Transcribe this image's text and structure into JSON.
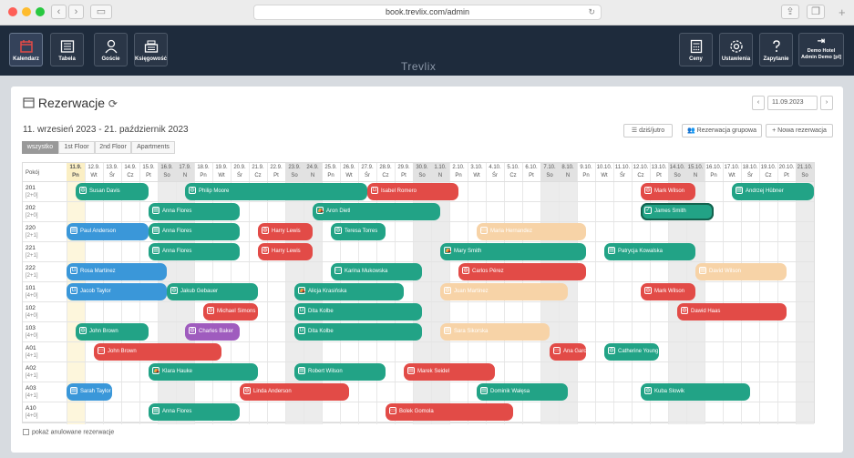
{
  "browser": {
    "url": "book.trevlix.com/admin"
  },
  "nav": {
    "brand": "Trevlix",
    "left": [
      {
        "label": "Kalendarz",
        "icon": "calendar-icon",
        "active": true
      },
      {
        "label": "Tabela",
        "icon": "table-icon"
      },
      {
        "label": "Goście",
        "icon": "user-icon"
      },
      {
        "label": "Księgowość",
        "icon": "cash-register-icon"
      }
    ],
    "right": [
      {
        "label": "Ceny",
        "icon": "calculator-icon"
      },
      {
        "label": "Ustawienia",
        "icon": "gear-icon"
      },
      {
        "label": "Zapytanie",
        "icon": "question-icon"
      }
    ],
    "hotel": {
      "line1": "Demo Hotel",
      "line2": "Admin Demo [pl]"
    }
  },
  "page": {
    "title": "Rezerwacje",
    "date": "11.09.2023",
    "range": "11. wrzesień 2023 - 21. październik 2023",
    "buttons": {
      "today": "dziś/jutro",
      "group": "Rezerwacja grupowa",
      "new": "+ Nowa rezerwacja"
    },
    "tabs": [
      "wszystko",
      "1st Floor",
      "2nd Floor",
      "Apartments"
    ],
    "column_header": "Pokój",
    "show_cancelled": "pokaż anulowane rezerwacje"
  },
  "days": [
    [
      "11.9.",
      "Pn"
    ],
    [
      "12.9.",
      "Wt"
    ],
    [
      "13.9.",
      "Śr"
    ],
    [
      "14.9.",
      "Cz"
    ],
    [
      "15.9.",
      "Pt"
    ],
    [
      "16.9.",
      "So"
    ],
    [
      "17.9.",
      "N"
    ],
    [
      "18.9.",
      "Pn"
    ],
    [
      "19.9.",
      "Wt"
    ],
    [
      "20.9.",
      "Śr"
    ],
    [
      "21.9.",
      "Cz"
    ],
    [
      "22.9.",
      "Pt"
    ],
    [
      "23.9.",
      "So"
    ],
    [
      "24.9.",
      "N"
    ],
    [
      "25.9.",
      "Pn"
    ],
    [
      "26.9.",
      "Wt"
    ],
    [
      "27.9.",
      "Śr"
    ],
    [
      "28.9.",
      "Cz"
    ],
    [
      "29.9.",
      "Pt"
    ],
    [
      "30.9.",
      "So"
    ],
    [
      "1.10.",
      "N"
    ],
    [
      "2.10.",
      "Pn"
    ],
    [
      "3.10.",
      "Wt"
    ],
    [
      "4.10.",
      "Śr"
    ],
    [
      "5.10.",
      "Cz"
    ],
    [
      "6.10.",
      "Pt"
    ],
    [
      "7.10.",
      "So"
    ],
    [
      "8.10.",
      "N"
    ],
    [
      "9.10.",
      "Pn"
    ],
    [
      "10.10.",
      "Wt"
    ],
    [
      "11.10.",
      "Śr"
    ],
    [
      "12.10.",
      "Cz"
    ],
    [
      "13.10.",
      "Pt"
    ],
    [
      "14.10.",
      "So"
    ],
    [
      "15.10.",
      "N"
    ],
    [
      "16.10.",
      "Pn"
    ],
    [
      "17.10.",
      "Wt"
    ],
    [
      "18.10.",
      "Śr"
    ],
    [
      "19.10.",
      "Cz"
    ],
    [
      "20.10.",
      "Pt"
    ],
    [
      "21.10.",
      "So"
    ]
  ],
  "rooms": [
    {
      "name": "201",
      "cap": "[2+0]"
    },
    {
      "name": "202",
      "cap": "[2+0]"
    },
    {
      "name": "220",
      "cap": "[2+1]"
    },
    {
      "name": "221",
      "cap": "[2+1]"
    },
    {
      "name": "222",
      "cap": "[2+1]"
    },
    {
      "name": "101",
      "cap": "[4+0]"
    },
    {
      "name": "102",
      "cap": "[4+0]"
    },
    {
      "name": "103",
      "cap": "[4+0]"
    },
    {
      "name": "A01",
      "cap": "[4+1]"
    },
    {
      "name": "A02",
      "cap": "[4+1]"
    },
    {
      "name": "A03",
      "cap": "[4+1]"
    },
    {
      "name": "A10",
      "cap": "[4+0]"
    }
  ],
  "reservations": [
    {
      "row": 0,
      "start": 0.5,
      "end": 4.5,
      "name": "Susan Davis",
      "color": "g",
      "icon": "globe"
    },
    {
      "row": 0,
      "start": 6.5,
      "end": 16.5,
      "name": "Philip Moore",
      "color": "g",
      "icon": "globe"
    },
    {
      "row": 0,
      "start": 16.5,
      "end": 21.5,
      "name": "Isabel Romero",
      "color": "r",
      "icon": "G"
    },
    {
      "row": 0,
      "start": 31.5,
      "end": 34.5,
      "name": "Mark Wilson",
      "color": "r",
      "icon": "globe"
    },
    {
      "row": 0,
      "start": 36.5,
      "end": 43,
      "name": "Andrzej Hübner",
      "color": "g",
      "icon": "card"
    },
    {
      "row": 1,
      "start": 4.5,
      "end": 9.5,
      "name": "Anna Flores",
      "color": "g",
      "icon": "card"
    },
    {
      "row": 1,
      "start": 13.5,
      "end": 20.5,
      "name": "Aron Dietl",
      "color": "g",
      "icon": "tent"
    },
    {
      "row": 1,
      "start": 31.5,
      "end": 35.5,
      "name": "James Smith",
      "color": "g",
      "icon": "check",
      "sel": true
    },
    {
      "row": 2,
      "start": 0,
      "end": 4.5,
      "name": "Paul Anderson",
      "color": "b",
      "icon": "card"
    },
    {
      "row": 2,
      "start": 4.5,
      "end": 9.5,
      "name": "Anna Flores",
      "color": "g",
      "icon": "card"
    },
    {
      "row": 2,
      "start": 10.5,
      "end": 13.5,
      "name": "Harry Lewis",
      "color": "r",
      "icon": "globe"
    },
    {
      "row": 2,
      "start": 14.5,
      "end": 17.5,
      "name": "Teresa Torres",
      "color": "g",
      "icon": "globe"
    },
    {
      "row": 2,
      "start": 22.5,
      "end": 28.5,
      "name": "Maria Hernandez",
      "color": "o",
      "icon": "screen"
    },
    {
      "row": 3,
      "start": 4.5,
      "end": 9.5,
      "name": "Anna Flores",
      "color": "g",
      "icon": "card"
    },
    {
      "row": 3,
      "start": 10.5,
      "end": 13.5,
      "name": "Harry Lewis",
      "color": "r",
      "icon": "globe"
    },
    {
      "row": 3,
      "start": 20.5,
      "end": 28.5,
      "name": "Mary Smith",
      "color": "g",
      "icon": "tent"
    },
    {
      "row": 3,
      "start": 29.5,
      "end": 34.5,
      "name": "Patrycja Kowalska",
      "color": "g",
      "icon": "card"
    },
    {
      "row": 4,
      "start": 0,
      "end": 5.5,
      "name": "Rosa Martinez",
      "color": "b",
      "icon": "G"
    },
    {
      "row": 4,
      "start": 14.5,
      "end": 19.5,
      "name": "Karina Mukowska",
      "color": "g",
      "icon": "screen"
    },
    {
      "row": 4,
      "start": 21.5,
      "end": 28.5,
      "name": "Carlos Pérez",
      "color": "r",
      "icon": "globe"
    },
    {
      "row": 4,
      "start": 34.5,
      "end": 39.5,
      "name": "David Wilson",
      "color": "o",
      "icon": "card"
    },
    {
      "row": 5,
      "start": 0,
      "end": 5.5,
      "name": "Jacob Taylor",
      "color": "b",
      "icon": "G"
    },
    {
      "row": 5,
      "start": 5.5,
      "end": 10.5,
      "name": "Jakub Gebauer",
      "color": "g",
      "icon": "globe"
    },
    {
      "row": 5,
      "start": 12.5,
      "end": 18.5,
      "name": "Alicja Krasińska",
      "color": "g",
      "icon": "tent"
    },
    {
      "row": 5,
      "start": 20.5,
      "end": 27.5,
      "name": "Juan Martinez",
      "color": "o",
      "icon": "globe"
    },
    {
      "row": 5,
      "start": 31.5,
      "end": 34.5,
      "name": "Mark Wilson",
      "color": "r",
      "icon": "globe"
    },
    {
      "row": 6,
      "start": 7.5,
      "end": 10.5,
      "name": "Michael Simons",
      "color": "r",
      "icon": "globe"
    },
    {
      "row": 6,
      "start": 12.5,
      "end": 19.5,
      "name": "Dita Kolbe",
      "color": "g",
      "icon": "G"
    },
    {
      "row": 6,
      "start": 33.5,
      "end": 39.5,
      "name": "Dawid Haas",
      "color": "r",
      "icon": "globe"
    },
    {
      "row": 7,
      "start": 0.5,
      "end": 4.5,
      "name": "John Brown",
      "color": "g",
      "icon": "globe"
    },
    {
      "row": 7,
      "start": 6.5,
      "end": 9.5,
      "name": "Charles Baker",
      "color": "p",
      "icon": "globe"
    },
    {
      "row": 7,
      "start": 12.5,
      "end": 19.5,
      "name": "Dita Kolbe",
      "color": "g",
      "icon": "G"
    },
    {
      "row": 7,
      "start": 20.5,
      "end": 26.5,
      "name": "Sara Sikorska",
      "color": "o",
      "icon": "card"
    },
    {
      "row": 8,
      "start": 1.5,
      "end": 8.5,
      "name": "John Brown",
      "color": "r",
      "icon": "screen"
    },
    {
      "row": 8,
      "start": 26.5,
      "end": 28.5,
      "name": "Ana García",
      "color": "r",
      "icon": "screen"
    },
    {
      "row": 8,
      "start": 29.5,
      "end": 32.5,
      "name": "Catherine Young",
      "color": "g",
      "icon": "globe"
    },
    {
      "row": 9,
      "start": 4.5,
      "end": 10.5,
      "name": "Klara Hauke",
      "color": "g",
      "icon": "tent"
    },
    {
      "row": 9,
      "start": 12.5,
      "end": 17.5,
      "name": "Robert Wilson",
      "color": "g",
      "icon": "card"
    },
    {
      "row": 9,
      "start": 18.5,
      "end": 23.5,
      "name": "Marek Seidel",
      "color": "r",
      "icon": "card"
    },
    {
      "row": 10,
      "start": 0,
      "end": 2.5,
      "name": "Sarah Taylor",
      "color": "b",
      "icon": "card"
    },
    {
      "row": 10,
      "start": 9.5,
      "end": 15.5,
      "name": "Linda Anderson",
      "color": "r",
      "icon": "globe"
    },
    {
      "row": 10,
      "start": 22.5,
      "end": 27.5,
      "name": "Dominik Wałęsa",
      "color": "g",
      "icon": "card"
    },
    {
      "row": 10,
      "start": 31.5,
      "end": 37.5,
      "name": "Kuba Slowik",
      "color": "g",
      "icon": "globe"
    },
    {
      "row": 11,
      "start": 4.5,
      "end": 9.5,
      "name": "Anna Flores",
      "color": "g",
      "icon": "card"
    },
    {
      "row": 11,
      "start": 17.5,
      "end": 24.5,
      "name": "Bolek Gomola",
      "color": "r",
      "icon": "screen"
    }
  ]
}
